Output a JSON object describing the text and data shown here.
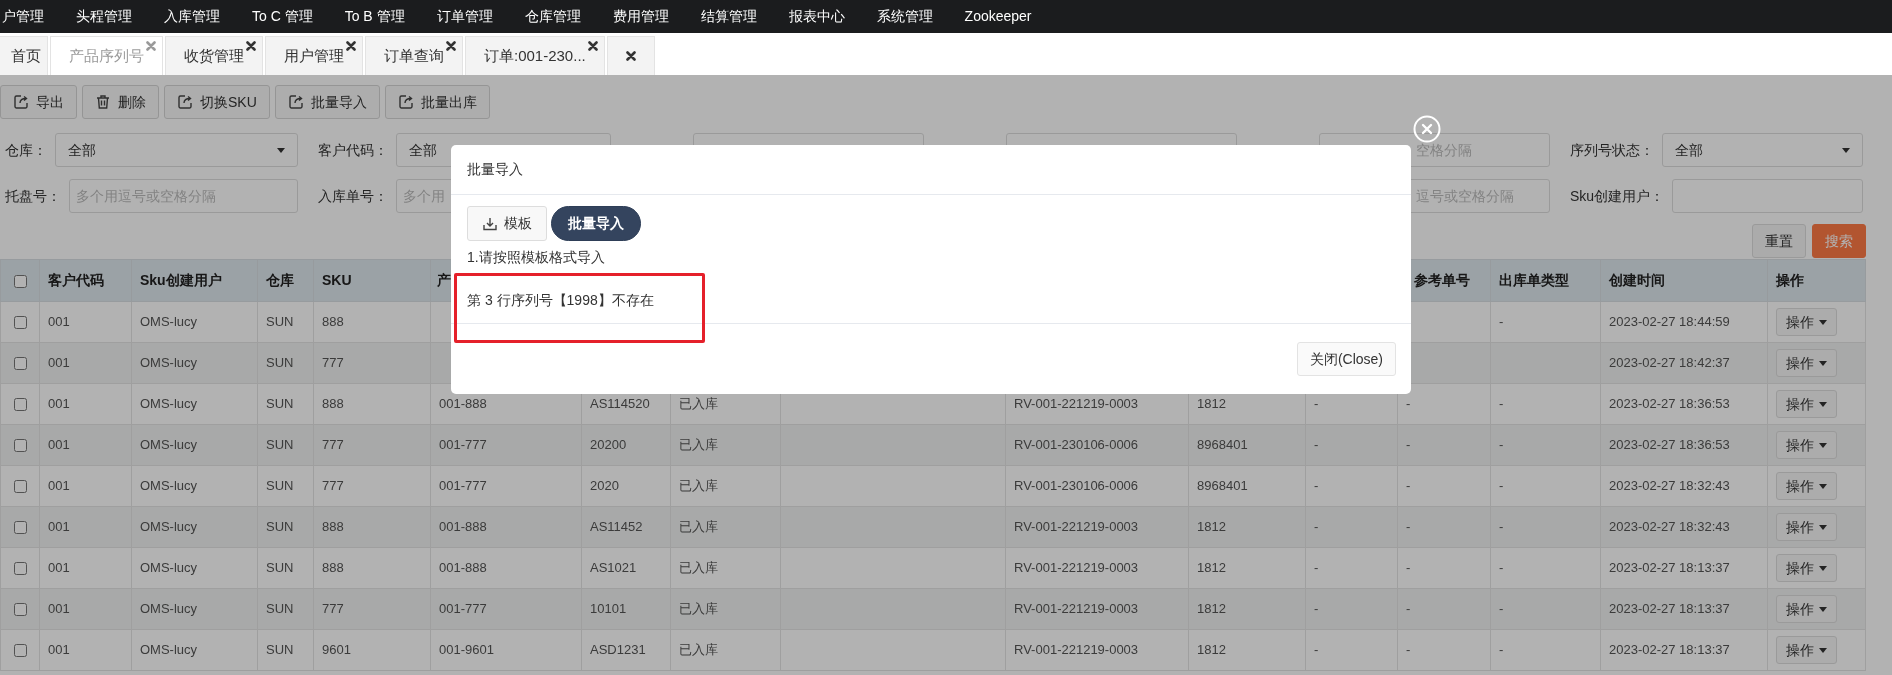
{
  "nav": {
    "items": [
      "户管理",
      "头程管理",
      "入库管理",
      "To C 管理",
      "To B 管理",
      "订单管理",
      "仓库管理",
      "费用管理",
      "结算管理",
      "报表中心",
      "系统管理",
      "Zookeeper"
    ]
  },
  "tabs": [
    {
      "label": "首页",
      "selected": false,
      "closable": false
    },
    {
      "label": "产品序列号",
      "selected": true,
      "closable": true
    },
    {
      "label": "收货管理",
      "selected": false,
      "closable": true
    },
    {
      "label": "用户管理",
      "selected": false,
      "closable": true
    },
    {
      "label": "订单查询",
      "selected": false,
      "closable": true
    },
    {
      "label": "订单:001-230...",
      "selected": false,
      "closable": true
    },
    {
      "selected": false,
      "closable": true
    }
  ],
  "toolbar": [
    {
      "label": "导出",
      "kind": "export"
    },
    {
      "label": "删除",
      "kind": "delete"
    },
    {
      "label": "切换SKU",
      "kind": "export"
    },
    {
      "label": "批量导入",
      "kind": "export"
    },
    {
      "label": "批量出库",
      "kind": "export"
    }
  ],
  "filters": [
    [
      {
        "label": "仓库：",
        "kind": "select",
        "value": "全部"
      },
      {
        "label": "客户代码：",
        "kind": "select",
        "value": "全部"
      },
      {
        "kind": "input"
      },
      {
        "kind": "input"
      },
      {
        "kind": "input",
        "placeholder": "空格分隔"
      },
      {
        "label": "序列号状态：",
        "kind": "select",
        "value": "全部"
      }
    ],
    [
      {
        "label": "托盘号：",
        "kind": "input",
        "placeholder": "多个用逗号或空格分隔"
      },
      {
        "label": "入库单号：",
        "kind": "input",
        "placeholder": "多个用"
      },
      {
        "kind": "input",
        "placeholder": "逗号或空格分隔"
      },
      {
        "label": "Sku创建用户：",
        "kind": "input"
      }
    ]
  ],
  "actions": [
    {
      "label": "重置",
      "kind": "default"
    },
    {
      "label": "搜索",
      "kind": "primary"
    }
  ],
  "table": {
    "header_checked": false,
    "columns": [
      "客户代码",
      "Sku创建用户",
      "仓库",
      "SKU",
      "产",
      null,
      null,
      null,
      null,
      null,
      null,
      "参考单号",
      "出库单类型",
      "创建时间",
      "操作"
    ],
    "rows": [
      {
        "checked": false,
        "cells": [
          "001",
          "OMS-lucy",
          "SUN",
          "888",
          null,
          null,
          null,
          null,
          null,
          null,
          null,
          null,
          "-",
          "2023-02-27 18:44:59"
        ],
        "action": "操作"
      },
      {
        "checked": false,
        "cells": [
          "001",
          "OMS-lucy",
          "SUN",
          "777",
          null,
          null,
          null,
          null,
          null,
          null,
          null,
          null,
          null,
          "2023-02-27 18:42:37"
        ],
        "action": "操作"
      },
      {
        "checked": false,
        "cells": [
          "001",
          "OMS-lucy",
          "SUN",
          "888",
          "001-888",
          "AS114520",
          "已入库",
          null,
          "RV-001-221219-0003",
          "1812",
          "-",
          "-",
          "-",
          "2023-02-27 18:36:53"
        ],
        "action": "操作"
      },
      {
        "checked": false,
        "cells": [
          "001",
          "OMS-lucy",
          "SUN",
          "777",
          "001-777",
          "20200",
          "已入库",
          null,
          "RV-001-230106-0006",
          "8968401",
          "-",
          "-",
          "-",
          "2023-02-27 18:36:53"
        ],
        "action": "操作"
      },
      {
        "checked": false,
        "cells": [
          "001",
          "OMS-lucy",
          "SUN",
          "777",
          "001-777",
          "2020",
          "已入库",
          null,
          "RV-001-230106-0006",
          "8968401",
          "-",
          "-",
          "-",
          "2023-02-27 18:32:43"
        ],
        "action": "操作"
      },
      {
        "checked": false,
        "cells": [
          "001",
          "OMS-lucy",
          "SUN",
          "888",
          "001-888",
          "AS11452",
          "已入库",
          null,
          "RV-001-221219-0003",
          "1812",
          "-",
          "-",
          "-",
          "2023-02-27 18:32:43"
        ],
        "action": "操作"
      },
      {
        "checked": false,
        "cells": [
          "001",
          "OMS-lucy",
          "SUN",
          "888",
          "001-888",
          "AS1021",
          "已入库",
          null,
          "RV-001-221219-0003",
          "1812",
          "-",
          "-",
          "-",
          "2023-02-27 18:13:37"
        ],
        "action": "操作"
      },
      {
        "checked": false,
        "cells": [
          "001",
          "OMS-lucy",
          "SUN",
          "777",
          "001-777",
          "10101",
          "已入库",
          null,
          "RV-001-221219-0003",
          "1812",
          "-",
          "-",
          "-",
          "2023-02-27 18:13:37"
        ],
        "action": "操作"
      },
      {
        "checked": false,
        "cells": [
          "001",
          "OMS-lucy",
          "SUN",
          "9601",
          "001-9601",
          "ASD1231",
          "已入库",
          null,
          "RV-001-221219-0003",
          "1812",
          "-",
          "-",
          "-",
          "2023-02-27 18:13:37"
        ],
        "action": "操作"
      }
    ]
  },
  "modal": {
    "title": "批量导入",
    "buttons": [
      {
        "label": "模板",
        "kind": "download"
      },
      {
        "label": "批量导入",
        "kind": "upload"
      }
    ],
    "hint": "1.请按照模板格式导入",
    "message": "第 3 行序列号【1998】不存在",
    "close_label": "关闭(Close)"
  }
}
